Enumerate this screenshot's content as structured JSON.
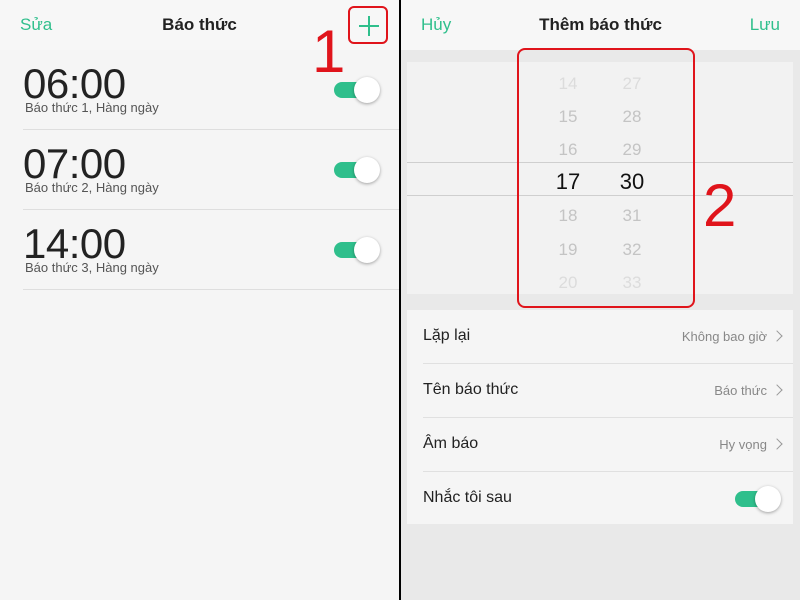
{
  "left": {
    "nav": {
      "edit": "Sửa",
      "title": "Báo thức"
    },
    "marker": "1",
    "alarms": [
      {
        "time": "06:00",
        "subtitle": "Báo thức 1, Hàng ngày",
        "enabled": true
      },
      {
        "time": "07:00",
        "subtitle": "Báo thức 2, Hàng ngày",
        "enabled": true
      },
      {
        "time": "14:00",
        "subtitle": "Báo thức 3, Hàng ngày",
        "enabled": true
      }
    ]
  },
  "right": {
    "nav": {
      "cancel": "Hủy",
      "title": "Thêm báo thức",
      "save": "Lưu"
    },
    "marker": "2",
    "picker": {
      "hours": [
        "14",
        "15",
        "16",
        "17",
        "18",
        "19",
        "20"
      ],
      "minutes": [
        "27",
        "28",
        "29",
        "30",
        "31",
        "32",
        "33"
      ],
      "selected_hour": "17",
      "selected_minute": "30"
    },
    "settings": [
      {
        "label": "Lặp lại",
        "value": "Không bao giờ"
      },
      {
        "label": "Tên báo thức",
        "value": "Báo thức"
      },
      {
        "label": "Âm báo",
        "value": "Hy vọng"
      },
      {
        "label": "Nhắc tôi sau",
        "toggle": true
      }
    ]
  },
  "colors": {
    "accent": "#2fbf8c",
    "annotation": "#e0141b"
  }
}
